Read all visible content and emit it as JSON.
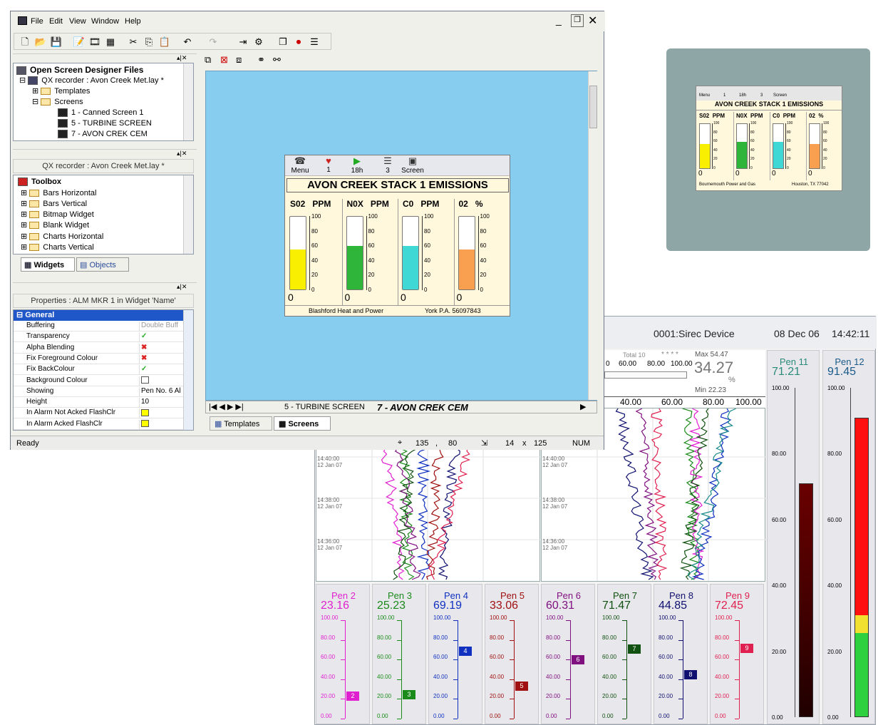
{
  "app": {
    "menu": [
      "File",
      "Edit",
      "View",
      "Window",
      "Help"
    ],
    "status": {
      "ready": "Ready",
      "x": "135",
      "y": "80",
      "w": "14",
      "h": "125",
      "num": "NUM",
      "sep1": ",",
      "sep2": "x"
    },
    "files_panel": {
      "title": "Open Screen Designer Files",
      "project": "QX recorder : Avon Creek Met.lay *",
      "templates": "Templates",
      "screens": "Screens",
      "screen_items": [
        "1 - Canned Screen 1",
        "5 - TURBINE SCREEN",
        "7 - AVON CREK CEM"
      ]
    },
    "toolbox_panel": {
      "header": "QX recorder : Avon Creek Met.lay *",
      "title": "Toolbox",
      "items": [
        "Bars Horizontal",
        "Bars Vertical",
        "Bitmap Widget",
        "Blank Widget",
        "Charts Horizontal",
        "Charts Vertical"
      ],
      "tab_widgets": "Widgets",
      "tab_objects": "Objects"
    },
    "properties": {
      "header": "Properties : ALM MKR 1 in Widget 'Name'",
      "section": "General",
      "rows": [
        {
          "key": "Buffering",
          "value": "Double Buff"
        },
        {
          "key": "Transparency",
          "value": "✓"
        },
        {
          "key": "Alpha Blending",
          "value": "✖"
        },
        {
          "key": "Fix Foreground Colour",
          "value": "✖"
        },
        {
          "key": "Fix BackColour",
          "value": "✓"
        },
        {
          "key": "Background Colour",
          "value": ""
        },
        {
          "key": "Showing",
          "value": "Pen No. 6 Al"
        },
        {
          "key": "Height",
          "value": "10"
        },
        {
          "key": "In Alarm Not Acked FlashClr",
          "value": ""
        },
        {
          "key": "In Alarm Acked FlashClr",
          "value": ""
        }
      ]
    },
    "canvas_tabs": [
      "5 - TURBINE SCREEN",
      "7 - AVON CREK CEM"
    ],
    "bottom_tabs": {
      "templates": "Templates",
      "screens": "Screens"
    }
  },
  "emissions_widget": {
    "buttons": [
      {
        "label": "Menu",
        "icon": "menu-icon"
      },
      {
        "label": "1",
        "icon": "alarm-bell-icon"
      },
      {
        "label": "18h",
        "icon": "play-icon"
      },
      {
        "label": "3",
        "icon": "list-icon"
      },
      {
        "label": "Screen",
        "icon": "screen-icon"
      }
    ],
    "title": "AVON CREEK STACK 1 EMISSIONS",
    "gauges": [
      {
        "name": "S02",
        "unit": "PPM",
        "level": 0.55,
        "color": "#f8f000",
        "zero": "0"
      },
      {
        "name": "N0X",
        "unit": "PPM",
        "level": 0.6,
        "color": "#2fb53a",
        "zero": "0"
      },
      {
        "name": "C0",
        "unit": "PPM",
        "level": 0.6,
        "color": "#3fd8d4",
        "zero": "0"
      },
      {
        "name": "02",
        "unit": "%",
        "level": 0.55,
        "color": "#f8a050",
        "zero": "0"
      }
    ],
    "scale": [
      "100",
      "80",
      "60",
      "40",
      "20",
      "0"
    ],
    "footer_left": "Blashford Heat and Power",
    "footer_right": "York P.A. 56097843"
  },
  "preview_widget": {
    "buttons": [
      "Menu",
      "1",
      "18h",
      "3",
      "Screen"
    ],
    "title": "AVON CREEK STACK 1 EMISSIONS",
    "gauges": [
      {
        "name": "S02",
        "unit": "PPM",
        "zero": "0"
      },
      {
        "name": "N0X",
        "unit": "PPM",
        "zero": "0"
      },
      {
        "name": "C0",
        "unit": "PPM",
        "zero": "0"
      },
      {
        "name": "02",
        "unit": "%",
        "zero": "0"
      }
    ],
    "footer_left": "Bournemouth Power and Gas",
    "footer_right": "Houston, TX 77042"
  },
  "recorder": {
    "device": "0001:Sirec Device",
    "date": "08 Dec 06",
    "time": "14:42:11",
    "total": "Total 10",
    "stars": "* * * *",
    "max": "Max  54.47",
    "min": "Min  22.23",
    "big_value": "34.27",
    "big_unit": "%",
    "top_scale": [
      "0",
      "60.00",
      "80.00",
      "100.00"
    ],
    "axis": [
      "40.00",
      "60.00",
      "80.00",
      "100.00"
    ],
    "timestamps": [
      {
        "time": "14:40:00",
        "date": "12 Jan 07"
      },
      {
        "time": "14:38:00",
        "date": "12 Jan 07"
      },
      {
        "time": "14:36:00",
        "date": "12 Jan 07"
      }
    ],
    "pens": [
      {
        "name": "Pen 2",
        "value": "23.16",
        "color": "#e020d0",
        "marker": "2",
        "level": 0.23
      },
      {
        "name": "Pen 3",
        "value": "25.23",
        "color": "#1a8a1a",
        "marker": "3",
        "level": 0.25
      },
      {
        "name": "Pen 4",
        "value": "69.19",
        "color": "#1030c0",
        "marker": "4",
        "level": 0.69
      },
      {
        "name": "Pen 5",
        "value": "33.06",
        "color": "#a01010",
        "marker": "5",
        "level": 0.33
      },
      {
        "name": "Pen 6",
        "value": "60.31",
        "color": "#801080",
        "marker": "6",
        "level": 0.6
      },
      {
        "name": "Pen 7",
        "value": "71.47",
        "color": "#105010",
        "marker": "7",
        "level": 0.71
      },
      {
        "name": "Pen 8",
        "value": "44.85",
        "color": "#101070",
        "marker": "8",
        "level": 0.45
      },
      {
        "name": "Pen 9",
        "value": "72.45",
        "color": "#e02050",
        "marker": "9",
        "level": 0.72
      }
    ],
    "pen_scale": [
      "100.00",
      "80.00",
      "60.00",
      "40.00",
      "20.00",
      "0.00"
    ],
    "bar_pens": [
      {
        "name": "Pen 11",
        "value": "71.21",
        "color": "#2a8a7a",
        "level": 0.71
      },
      {
        "name": "Pen 12",
        "value": "91.45",
        "color": "#1a5a8a",
        "level": 0.91
      }
    ],
    "bar_scale_11": [
      "100.00",
      "80.00",
      "60.00",
      "40.00",
      "20.00",
      "0.00"
    ],
    "bar_scale_12": [
      "100.00",
      "80.00",
      "60.00",
      "40.00",
      "20.00",
      "0.00"
    ]
  }
}
